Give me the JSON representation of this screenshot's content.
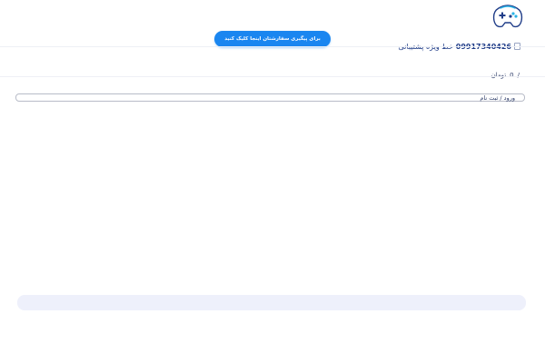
{
  "header": {
    "logo_icon": "gamepad-icon",
    "support_label": "خط ویژه پشتیبانی",
    "support_phone": "09917340426",
    "phone_icon": "phone-icon",
    "track_button_label": "برای پیگیری سفارشتان اینجا کلیک کنید"
  },
  "cart": {
    "amount": "0",
    "currency": "تومان",
    "separator": "/"
  },
  "account": {
    "login_label": "ورود / ثبت نام"
  },
  "colors": {
    "accent": "#1a86f0",
    "text": "#2b3a67",
    "footer_band": "#eef0fb"
  }
}
